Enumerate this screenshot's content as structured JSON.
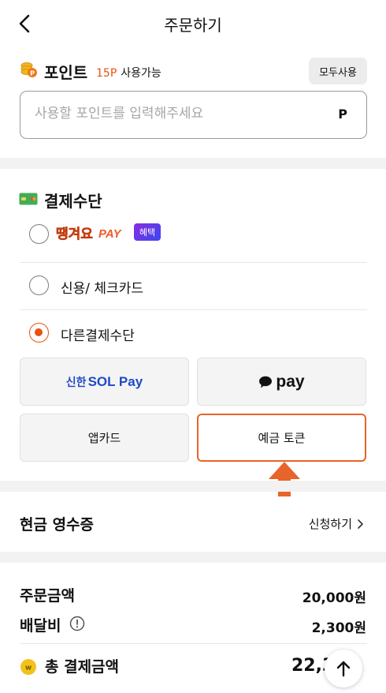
{
  "header": {
    "title": "주문하기",
    "back_icon": "chevron-left-icon"
  },
  "point": {
    "title": "포인트",
    "available_amount": "15P",
    "available_label": "사용가능",
    "use_all_label": "모두사용",
    "input_placeholder": "사용할 포인트를 입력해주세요",
    "input_value": "",
    "unit": "P",
    "icon": "coins-icon"
  },
  "payment": {
    "title": "결제수단",
    "icon": "card-icon",
    "options": [
      {
        "label": "땡겨요PAY",
        "badge": "혜택",
        "selected": false
      },
      {
        "label": "신용/ 체크카드",
        "selected": false
      },
      {
        "label": "다른결제수단",
        "selected": true
      }
    ],
    "methods": {
      "sol_prefix": "신한",
      "sol_name": "SOL Pay",
      "kakao_name": "pay",
      "appcard": "앱카드",
      "deposit_token": "예금 토큰"
    },
    "selected_method": "예금 토큰"
  },
  "receipt": {
    "title": "현금 영수증",
    "apply_label": "신청하기"
  },
  "summary": {
    "order_label": "주문금액",
    "order_value": "20,000원",
    "delivery_label": "배달비",
    "delivery_value": "2,300원",
    "total_label": "총 결제금액",
    "total_value": "22,3"
  },
  "colors": {
    "accent": "#e8530e",
    "selected_border": "#e8642a",
    "sol_blue": "#1f49c9",
    "divider": "#f2f2f2",
    "coin": "#f2c21b"
  }
}
